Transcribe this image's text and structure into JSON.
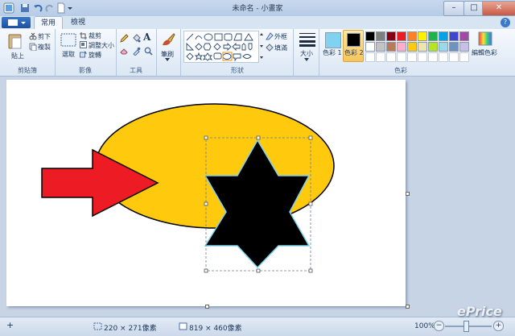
{
  "window": {
    "title": "未命名 - 小畫家",
    "minimize": "–",
    "maximize": "□",
    "close": "✕"
  },
  "ribbon": {
    "tabs": [
      {
        "label": "常用"
      },
      {
        "label": "檢視"
      }
    ],
    "clipboard": {
      "paste": "貼上",
      "cut": "剪下",
      "copy": "複製",
      "group": "剪貼簿"
    },
    "image": {
      "select": "選取",
      "crop": "裁剪",
      "resize": "調整大小",
      "rotate": "旋轉",
      "group": "影像"
    },
    "tools": {
      "group": "工具",
      "text_icon": "A"
    },
    "brushes": {
      "label": "筆刷"
    },
    "shapes": {
      "outline": "外框",
      "fill": "填滿",
      "group": "形狀"
    },
    "size": {
      "label": "大小"
    },
    "colors": {
      "color1": "色彩 1",
      "color2": "色彩 2",
      "edit": "編輯色彩",
      "group": "色彩",
      "color1_value": "#7fd3f0",
      "color2_value": "#000000",
      "palette_row1": [
        "#000000",
        "#7f7f7f",
        "#880015",
        "#ed1c24",
        "#ff7f27",
        "#fff200",
        "#22b14c",
        "#00a2e8",
        "#3f48cc",
        "#a349a4"
      ],
      "palette_row2": [
        "#ffffff",
        "#c3c3c3",
        "#b97a57",
        "#ffaec9",
        "#ffc90e",
        "#efe4b0",
        "#b5e61d",
        "#99d9ea",
        "#7092be",
        "#c8bfe7"
      ]
    },
    "help": "?"
  },
  "canvas_content": {
    "ellipse_fill": "#ffc90e",
    "arrow_fill": "#ed1c24",
    "star_fill": "#000000",
    "star_outline": "#7fd3f0"
  },
  "status": {
    "add": "+",
    "selection_size": "220 × 271像素",
    "canvas_size": "819 × 460像素",
    "zoom": "100%",
    "zoom_out": "−",
    "zoom_in": "+"
  },
  "watermark": "ePrice"
}
